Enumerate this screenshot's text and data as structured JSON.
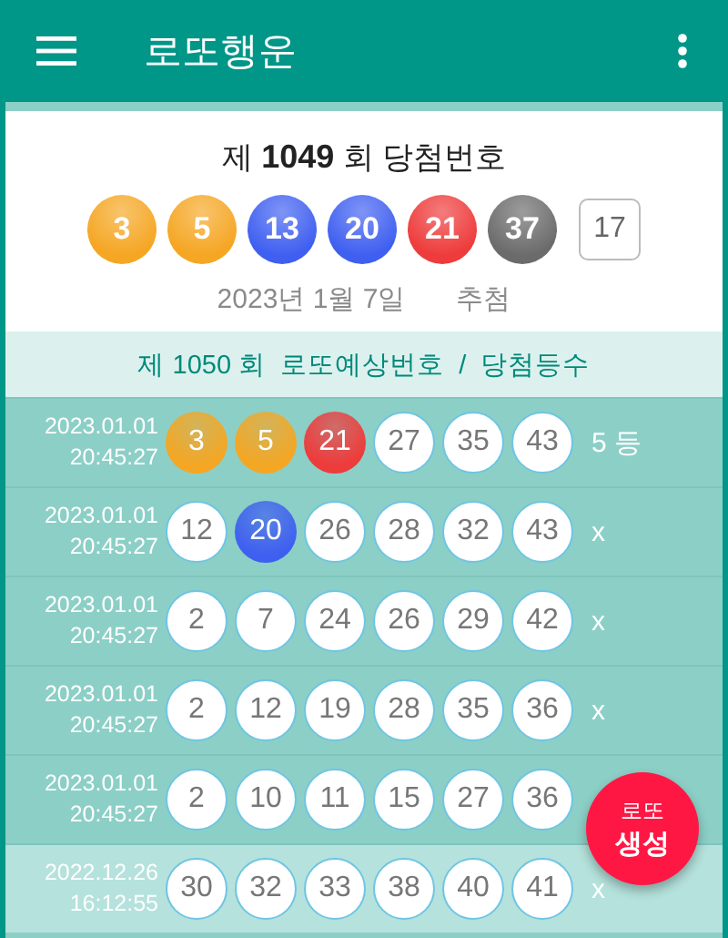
{
  "app_bar": {
    "title": "로또행운"
  },
  "draw": {
    "title": "제 **1049** 회 당첨번호",
    "balls": [
      {
        "number": "3",
        "color": "#f5a623"
      },
      {
        "number": "5",
        "color": "#f5a623"
      },
      {
        "number": "13",
        "color": "#3f5ff0"
      },
      {
        "number": "20",
        "color": "#3f5ff0"
      },
      {
        "number": "21",
        "color": "#ee3b3b"
      },
      {
        "number": "37",
        "color": "#6b6b6b"
      }
    ],
    "bonus": "17",
    "date": "2023년 1월 7일",
    "label": "추첨"
  },
  "list_header": "제 1050 회  로또예상번호  /  당첨등수",
  "rows": [
    {
      "date": "2023.01.01",
      "time": "20:45:27",
      "selected": false,
      "result": "5 등",
      "balls": [
        {
          "number": "3",
          "color": "#f5a623"
        },
        {
          "number": "5",
          "color": "#f5a623"
        },
        {
          "number": "21",
          "color": "#ee3b3b"
        },
        {
          "number": "27",
          "color": "#ffffff"
        },
        {
          "number": "35",
          "color": "#ffffff"
        },
        {
          "number": "43",
          "color": "#ffffff"
        }
      ]
    },
    {
      "date": "2023.01.01",
      "time": "20:45:27",
      "selected": false,
      "result": "x",
      "balls": [
        {
          "number": "12",
          "color": "#ffffff"
        },
        {
          "number": "20",
          "color": "#3f5ff0"
        },
        {
          "number": "26",
          "color": "#ffffff"
        },
        {
          "number": "28",
          "color": "#ffffff"
        },
        {
          "number": "32",
          "color": "#ffffff"
        },
        {
          "number": "43",
          "color": "#ffffff"
        }
      ]
    },
    {
      "date": "2023.01.01",
      "time": "20:45:27",
      "selected": false,
      "result": "x",
      "balls": [
        {
          "number": "2",
          "color": "#ffffff"
        },
        {
          "number": "7",
          "color": "#ffffff"
        },
        {
          "number": "24",
          "color": "#ffffff"
        },
        {
          "number": "26",
          "color": "#ffffff"
        },
        {
          "number": "29",
          "color": "#ffffff"
        },
        {
          "number": "42",
          "color": "#ffffff"
        }
      ]
    },
    {
      "date": "2023.01.01",
      "time": "20:45:27",
      "selected": false,
      "result": "x",
      "balls": [
        {
          "number": "2",
          "color": "#ffffff"
        },
        {
          "number": "12",
          "color": "#ffffff"
        },
        {
          "number": "19",
          "color": "#ffffff"
        },
        {
          "number": "28",
          "color": "#ffffff"
        },
        {
          "number": "35",
          "color": "#ffffff"
        },
        {
          "number": "36",
          "color": "#ffffff"
        }
      ]
    },
    {
      "date": "2023.01.01",
      "time": "20:45:27",
      "selected": false,
      "balls": [
        {
          "number": "2",
          "color": "#ffffff"
        },
        {
          "number": "10",
          "color": "#ffffff"
        },
        {
          "number": "11",
          "color": "#ffffff"
        },
        {
          "number": "15",
          "color": "#ffffff"
        },
        {
          "number": "27",
          "color": "#ffffff"
        },
        {
          "number": "36",
          "color": "#ffffff"
        }
      ]
    },
    {
      "date": "2022.12.26",
      "time": "16:12:55",
      "selected": true,
      "result": "x",
      "balls": [
        {
          "number": "30",
          "color": "#ffffff"
        },
        {
          "number": "32",
          "color": "#ffffff"
        },
        {
          "number": "33",
          "color": "#ffffff"
        },
        {
          "number": "38",
          "color": "#ffffff"
        },
        {
          "number": "40",
          "color": "#ffffff"
        },
        {
          "number": "41",
          "color": "#ffffff"
        }
      ]
    }
  ],
  "fab": {
    "lines": [
      "로또",
      "생성"
    ]
  }
}
